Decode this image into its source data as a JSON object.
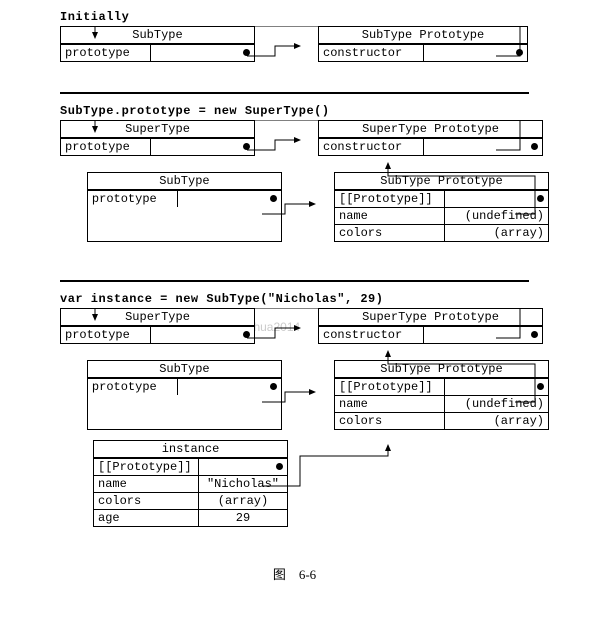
{
  "stage1": {
    "title": "Initially",
    "sub": {
      "header": "SubType",
      "prop": "prototype"
    },
    "subproto": {
      "header": "SubType Prototype",
      "prop": "constructor"
    }
  },
  "stage2": {
    "title": "SubType.prototype = new SuperType()",
    "super": {
      "header": "SuperType",
      "prop": "prototype"
    },
    "superproto": {
      "header": "SuperType Prototype",
      "prop": "constructor"
    },
    "sub": {
      "header": "SubType",
      "prop": "prototype"
    },
    "subproto": {
      "header": "SubType Prototype",
      "r1k": "[[Prototype]]",
      "r2k": "name",
      "r2v": "(undefined)",
      "r3k": "colors",
      "r3v": "(array)"
    }
  },
  "stage3": {
    "title": "var instance = new SubType(\"Nicholas\", 29)",
    "super": {
      "header": "SuperType",
      "prop": "prototype"
    },
    "superproto": {
      "header": "SuperType Prototype",
      "prop": "constructor"
    },
    "sub": {
      "header": "SubType",
      "prop": "prototype"
    },
    "subproto": {
      "header": "SubType Prototype",
      "r1k": "[[Prototype]]",
      "r2k": "name",
      "r2v": "(undefined)",
      "r3k": "colors",
      "r3v": "(array)"
    },
    "instance": {
      "header": "instance",
      "r1k": "[[Prototype]]",
      "r2k": "name",
      "r2v": "\"Nicholas\"",
      "r3k": "colors",
      "r3v": "(array)",
      "r4k": "age",
      "r4v": "29"
    }
  },
  "caption": "图　6-6",
  "watermark": "http://blog.csdn.net/luozhonghua2014"
}
